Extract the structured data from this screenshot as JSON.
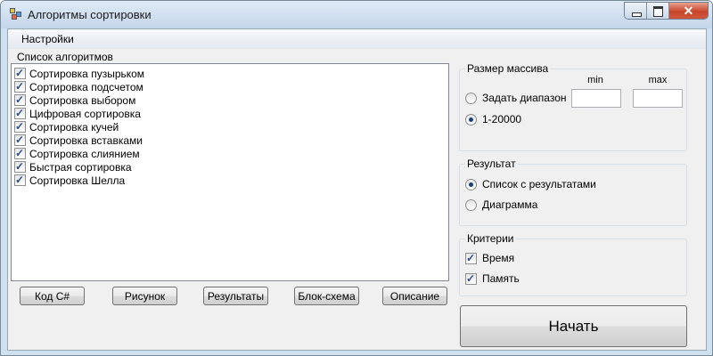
{
  "window": {
    "title": "Алгоритмы сортировки",
    "close_glyph": "✕"
  },
  "menu": {
    "items": [
      "Настройки"
    ]
  },
  "algorithms": {
    "label": "Список алгоритмов",
    "items": [
      {
        "label": "Сортировка пузырьком",
        "checked": true
      },
      {
        "label": "Сортировка подсчетом",
        "checked": true
      },
      {
        "label": "Сортировка выбором",
        "checked": true
      },
      {
        "label": "Цифровая сортировка",
        "checked": true
      },
      {
        "label": "Сортировка кучей",
        "checked": true
      },
      {
        "label": "Сортировка вставками",
        "checked": true
      },
      {
        "label": "Сортировка слиянием",
        "checked": true
      },
      {
        "label": "Быстрая сортировка",
        "checked": true
      },
      {
        "label": "Сортировка Шелла",
        "checked": true
      }
    ]
  },
  "buttons": {
    "code": "Код C#",
    "picture": "Рисунок",
    "results": "Результаты",
    "flowchart": "Блок-схема",
    "description": "Описание",
    "start": "Начать"
  },
  "array_size": {
    "label": "Размер массива",
    "min_label": "min",
    "max_label": "max",
    "min_value": "",
    "max_value": "",
    "options": [
      {
        "label": "Задать диапазон",
        "selected": false
      },
      {
        "label": "1-20000",
        "selected": true
      }
    ]
  },
  "result": {
    "label": "Результат",
    "options": [
      {
        "label": "Список с результатами",
        "selected": true
      },
      {
        "label": "Диаграмма",
        "selected": false
      }
    ]
  },
  "criteria": {
    "label": "Критерии",
    "items": [
      {
        "label": "Время",
        "checked": true
      },
      {
        "label": "Память",
        "checked": true
      }
    ]
  },
  "icons": {
    "app": "app-icon",
    "check": "✓"
  }
}
